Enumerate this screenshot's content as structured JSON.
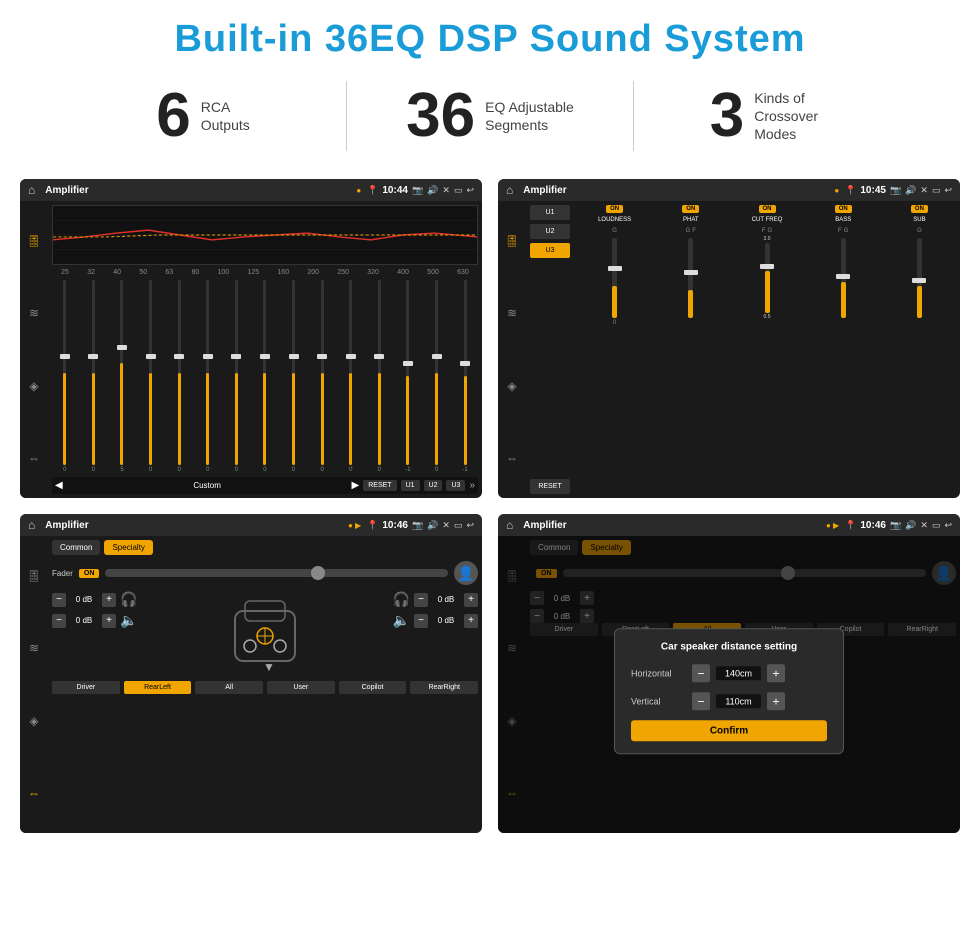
{
  "page": {
    "title": "Built-in 36EQ DSP Sound System",
    "stats": [
      {
        "number": "6",
        "label": "RCA\nOutputs"
      },
      {
        "number": "36",
        "label": "EQ Adjustable\nSegments"
      },
      {
        "number": "3",
        "label": "Kinds of\nCrossover Modes"
      }
    ]
  },
  "screenshots": {
    "eq": {
      "title": "Amplifier",
      "time": "10:44",
      "freq_labels": [
        "25",
        "32",
        "40",
        "50",
        "63",
        "80",
        "100",
        "125",
        "160",
        "200",
        "250",
        "320",
        "400",
        "500",
        "630"
      ],
      "slider_values": [
        "0",
        "0",
        "5",
        "0",
        "0",
        "0",
        "0",
        "0",
        "0",
        "0",
        "0",
        "0",
        "-1",
        "0",
        "-1"
      ],
      "bottom_preset": "Custom",
      "buttons": [
        "U1",
        "U2",
        "U3"
      ]
    },
    "crossover": {
      "title": "Amplifier",
      "time": "10:45",
      "presets": [
        "U1",
        "U2",
        "U3"
      ],
      "active_preset": "U3",
      "channels": [
        "LOUDNESS",
        "PHAT",
        "CUT FREQ",
        "BASS",
        "SUB"
      ],
      "channel_labels": [
        "G",
        "F",
        "F",
        "G",
        "G"
      ],
      "reset_label": "RESET"
    },
    "speaker": {
      "title": "Amplifier",
      "time": "10:46",
      "tabs": [
        "Common",
        "Specialty"
      ],
      "active_tab": "Specialty",
      "fader_label": "Fader",
      "fader_on": "ON",
      "channel_rows": [
        {
          "val": "0 dB"
        },
        {
          "val": "0 dB"
        },
        {
          "val": "0 dB"
        },
        {
          "val": "0 dB"
        }
      ],
      "bottom_buttons": [
        "Driver",
        "RearLeft",
        "All",
        "User",
        "Copilot",
        "RearRight"
      ],
      "active_btn": "All"
    },
    "distance": {
      "title": "Amplifier",
      "time": "10:46",
      "dialog_title": "Car speaker distance setting",
      "horizontal_label": "Horizontal",
      "horizontal_val": "140cm",
      "vertical_label": "Vertical",
      "vertical_val": "110cm",
      "confirm_label": "Confirm",
      "tabs": [
        "Common",
        "Specialty"
      ],
      "active_tab": "Specialty",
      "ch_vals": [
        "0 dB",
        "0 dB"
      ],
      "bottom_buttons": [
        "Driver",
        "RearLeft",
        "All",
        "User",
        "Copilot",
        "RearRight"
      ]
    }
  },
  "icons": {
    "home": "⌂",
    "eq_icon": "🎚",
    "wave_icon": "≋",
    "speaker_icon": "◈",
    "arrows_icon": "⇔",
    "settings": "⚙",
    "back": "↩"
  }
}
